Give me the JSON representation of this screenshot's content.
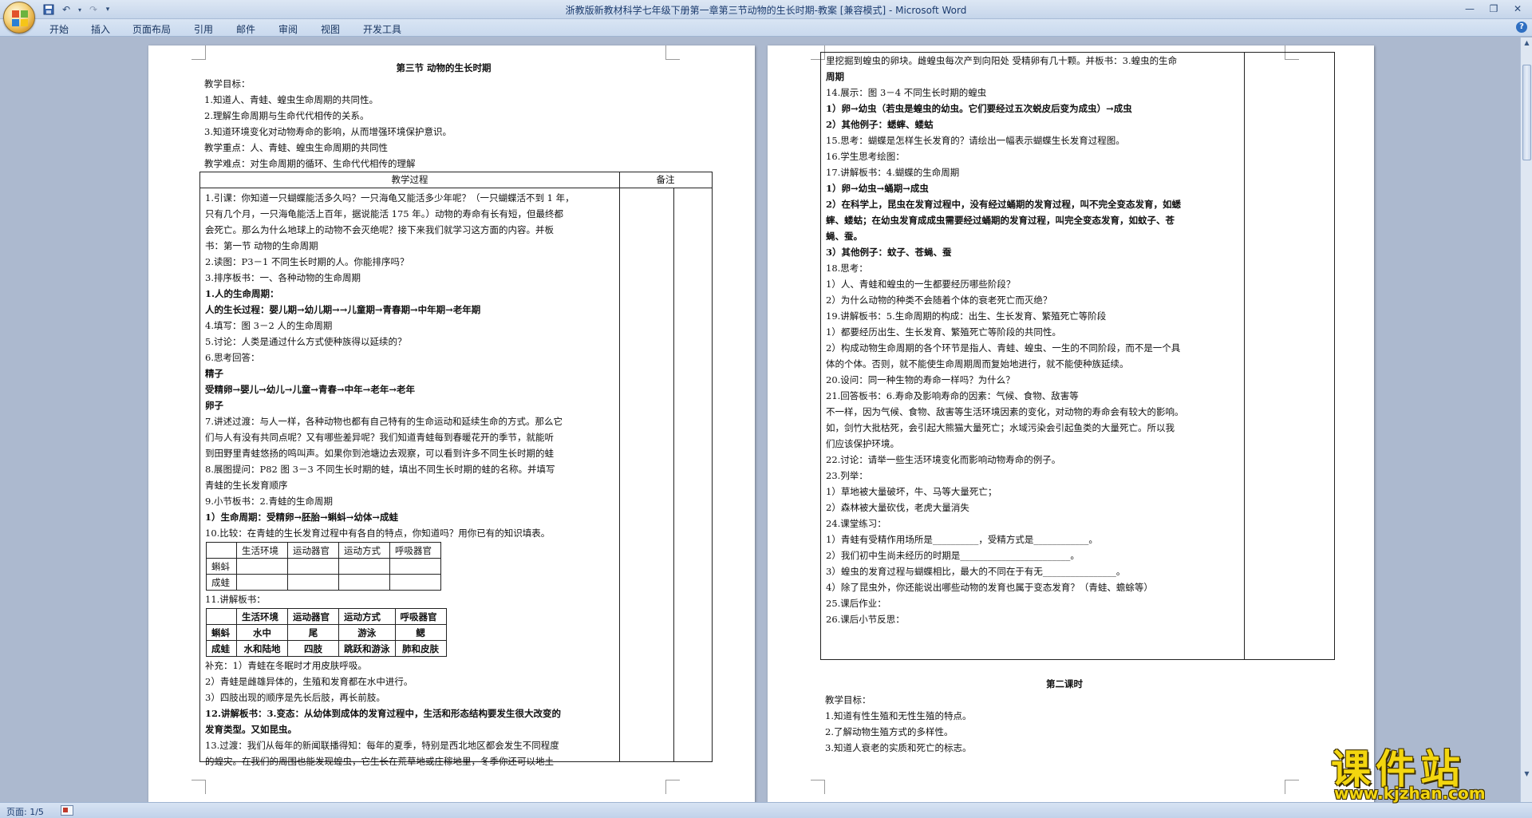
{
  "window": {
    "title": "浙教版新教材科学七年级下册第一章第三节动物的生长时期-教案 [兼容模式] - Microsoft Word"
  },
  "ribbon": {
    "tabs": [
      "开始",
      "插入",
      "页面布局",
      "引用",
      "邮件",
      "审阅",
      "视图",
      "开发工具"
    ]
  },
  "status": {
    "page": "页面: 1/5"
  },
  "watermark": {
    "brand": "课件站",
    "url": "www.kjzhan.com"
  },
  "left_page": {
    "title": "第三节    动物的生长时期",
    "intro": [
      "教学目标：",
      "1.知道人、青蛙、蝗虫生命周期的共同性。",
      "2.理解生命周期与生命代代相传的关系。",
      "3.知道环境变化对动物寿命的影响，从而增强环境保护意识。",
      "教学重点：人、青蛙、蝗虫生命周期的共同性",
      "教学难点：对生命周期的循环、生命代代相传的理解"
    ],
    "table_head": {
      "process": "教学过程",
      "notes": "备注"
    },
    "body_a": [
      {
        "t": "1.引课：你知道一只蝴蝶能活多久吗？一只海龟又能活多少年呢？（一只蝴蝶活不到 1 年，",
        "b": false
      },
      {
        "t": "只有几个月，一只海龟能活上百年，据说能活 175 年。）动物的寿命有长有短，但最终都",
        "b": false
      },
      {
        "t": "会死亡。那么为什么地球上的动物不会灭绝呢？接下来我们就学习这方面的内容。并板",
        "b": false
      },
      {
        "t": "书：第一节    动物的生命周期",
        "b": false
      },
      {
        "t": "2.读图：P3－1    不同生长时期的人。你能排序吗？",
        "b": false
      },
      {
        "t": "3.排序板书：一、各种动物的生命周期",
        "b": false
      },
      {
        "t": "1.人的生命周期：",
        "b": true
      },
      {
        "t": "人的生长过程：婴儿期→幼儿期→→儿童期→青春期→中年期→老年期",
        "b": true
      },
      {
        "t": "4.填写：图 3－2    人的生命周期",
        "b": false
      },
      {
        "t": "5.讨论：人类是通过什么方式使种族得以延续的？",
        "b": false
      },
      {
        "t": "6.思考回答：",
        "b": false
      },
      {
        "t": "精子",
        "b": true
      },
      {
        "t": "    受精卵→婴儿→幼儿→儿童→青春→中年→老年→老年",
        "b": true
      },
      {
        "t": "卵子",
        "b": true
      },
      {
        "t": "7.讲述过渡：与人一样，各种动物也都有自己特有的生命运动和延续生命的方式。那么它",
        "b": false
      },
      {
        "t": "们与人有没有共同点呢？又有哪些差异呢？我们知道青蛙每到春暖花开的季节，就能听",
        "b": false
      },
      {
        "t": "到田野里青蛙悠扬的鸣叫声。如果你到池塘边去观察，可以看到许多不同生长时期的蛙",
        "b": false
      },
      {
        "t": "8.展图提问：P82    图 3－3    不同生长时期的蛙，填出不同生长时期的蛙的名称。并填写",
        "b": false
      },
      {
        "t": "青蛙的生长发育顺序",
        "b": false
      },
      {
        "t": "9.小节板书：2.青蛙的生命周期",
        "b": false
      },
      {
        "t": "1）生命周期：受精卵→胚胎→蝌蚪→幼体→成蛙",
        "b": true
      },
      {
        "t": "10.比较：在青蛙的生长发育过程中有各自的特点，你知道吗？用你已有的知识填表。",
        "b": false
      }
    ],
    "compare_table": {
      "headers": [
        "",
        "生活环境",
        "运动器官",
        "运动方式",
        "呼吸器官"
      ],
      "rows": [
        [
          "蝌蚪",
          "",
          "",
          "",
          ""
        ],
        [
          "成蛙",
          "",
          "",
          "",
          ""
        ]
      ]
    },
    "explain_label": "11.讲解板书：",
    "answer_table": {
      "headers": [
        "",
        "生活环境",
        "运动器官",
        "运动方式",
        "呼吸器官"
      ],
      "rows": [
        [
          "蝌蚪",
          "水中",
          "尾",
          "游泳",
          "鳃"
        ],
        [
          "成蛙",
          "水和陆地",
          "四肢",
          "跳跃和游泳",
          "肺和皮肤"
        ]
      ]
    },
    "body_b": [
      {
        "t": "补充：1）青蛙在冬眠时才用皮肤呼吸。",
        "b": false
      },
      {
        "t": "2）青蛙是雌雄异体的，生殖和发育都在水中进行。",
        "b": false
      },
      {
        "t": "3）四肢出现的顺序是先长后肢，再长前肢。",
        "b": false
      },
      {
        "t": "12.讲解板书：3.变态：从幼体到成体的发育过程中，生活和形态结构要发生很大改变的",
        "b": true
      },
      {
        "t": "发育类型。又如昆虫。",
        "b": true
      },
      {
        "t": "13.过渡：我们从每年的新闻联播得知：每年的夏季，特别是西北地区都会发生不同程度",
        "b": false
      },
      {
        "t": "的蝗灾。在我们的周围也能发现蝗虫，它生长在荒草地或庄稼地里，冬季你还可以地土",
        "b": false
      }
    ]
  },
  "right_page": {
    "table_lines": [
      {
        "t": "里挖掘到蝗虫的卵块。雌蝗虫每次产到向阳处    受精卵有几十颗。并板书：3.蝗虫的生命",
        "b": false
      },
      {
        "t": "周期",
        "b": true
      },
      {
        "t": "14.展示：图 3－4    不同生长时期的蝗虫",
        "b": false
      },
      {
        "t": "1）卵→幼虫（若虫是蝗虫的幼虫。它们要经过五次蜕皮后变为成虫）→成虫",
        "b": true
      },
      {
        "t": "2）其他例子：蟋蟀、蝼蛄",
        "b": true
      },
      {
        "t": "15.思考：蝴蝶是怎样生长发育的？请绘出一幅表示蝴蝶生长发育过程图。",
        "b": false
      },
      {
        "t": "16.学生思考绘图：",
        "b": false
      },
      {
        "t": "17.讲解板书：4.蝴蝶的生命周期",
        "b": false
      },
      {
        "t": "1）卵→幼虫→蛹期→成虫",
        "b": true
      },
      {
        "t": "2）在科学上，昆虫在发育过程中，没有经过蛹期的发育过程，叫不完全变态发育，如蟋",
        "b": true
      },
      {
        "t": "蟀、蝼蛄；在幼虫发育成成虫需要经过蛹期的发育过程，叫完全变态发育，如蚊子、苍",
        "b": true
      },
      {
        "t": "蝇、蚕。",
        "b": true
      },
      {
        "t": "3）其他例子：蚊子、苍蝇、蚕",
        "b": true
      },
      {
        "t": "18.思考：",
        "b": false
      },
      {
        "t": "1）人、青蛙和蝗虫的一生都要经历哪些阶段？",
        "b": false
      },
      {
        "t": "2）为什么动物的种类不会随着个体的衰老死亡而灭绝？",
        "b": false
      },
      {
        "t": "19.讲解板书：5.生命周期的构成：出生、生长发育、繁殖死亡等阶段",
        "b": false
      },
      {
        "t": "1）都要经历出生、生长发育、繁殖死亡等阶段的共同性。",
        "b": false
      },
      {
        "t": "2）构成动物生命周期的各个环节是指人、青蛙、蝗虫、一生的不同阶段，而不是一个具",
        "b": false
      },
      {
        "t": "体的个体。否则，就不能使生命周期周而复始地进行，就不能使种族延续。",
        "b": false
      },
      {
        "t": "20.设问：同一种生物的寿命一样吗？为什么？",
        "b": false
      },
      {
        "t": "21.回答板书：6.寿命及影响寿命的因素：气候、食物、敌害等",
        "b": false
      },
      {
        "t": "不一样，因为气候、食物、敌害等生活环境因素的变化，对动物的寿命会有较大的影响。",
        "b": false
      },
      {
        "t": "如，剑竹大批枯死，会引起大熊猫大量死亡；水域污染会引起鱼类的大量死亡。所以我",
        "b": false
      },
      {
        "t": "们应该保护环境。",
        "b": false
      },
      {
        "t": "22.讨论：请举一些生活环境变化而影响动物寿命的例子。",
        "b": false
      },
      {
        "t": "23.列举：",
        "b": false
      },
      {
        "t": "1）草地被大量破坏，牛、马等大量死亡；",
        "b": false
      },
      {
        "t": "2）森林被大量砍伐，老虎大量消失",
        "b": false
      },
      {
        "t": "24.课堂练习：",
        "b": false
      },
      {
        "t": "1）青蛙有受精作用场所是__________，受精方式是____________。",
        "b": false
      },
      {
        "t": "2）我们初中生尚未经历的时期是________________________。",
        "b": false
      },
      {
        "t": "3）蝗虫的发育过程与蝴蝶相比，最大的不同在于有无________________。",
        "b": false
      },
      {
        "t": "4）除了昆虫外，你还能说出哪些动物的发育也属于变态发育？（青蛙、蟾蜍等）",
        "b": false
      },
      {
        "t": "25.课后作业：",
        "b": false
      },
      {
        "t": "26.课后小节反思：",
        "b": false
      }
    ],
    "second_title": "第二课时",
    "second_lines": [
      "教学目标：",
      "1.知道有性生殖和无性生殖的特点。",
      "2.了解动物生殖方式的多样性。",
      "3.知道人衰老的实质和死亡的标志。"
    ]
  }
}
